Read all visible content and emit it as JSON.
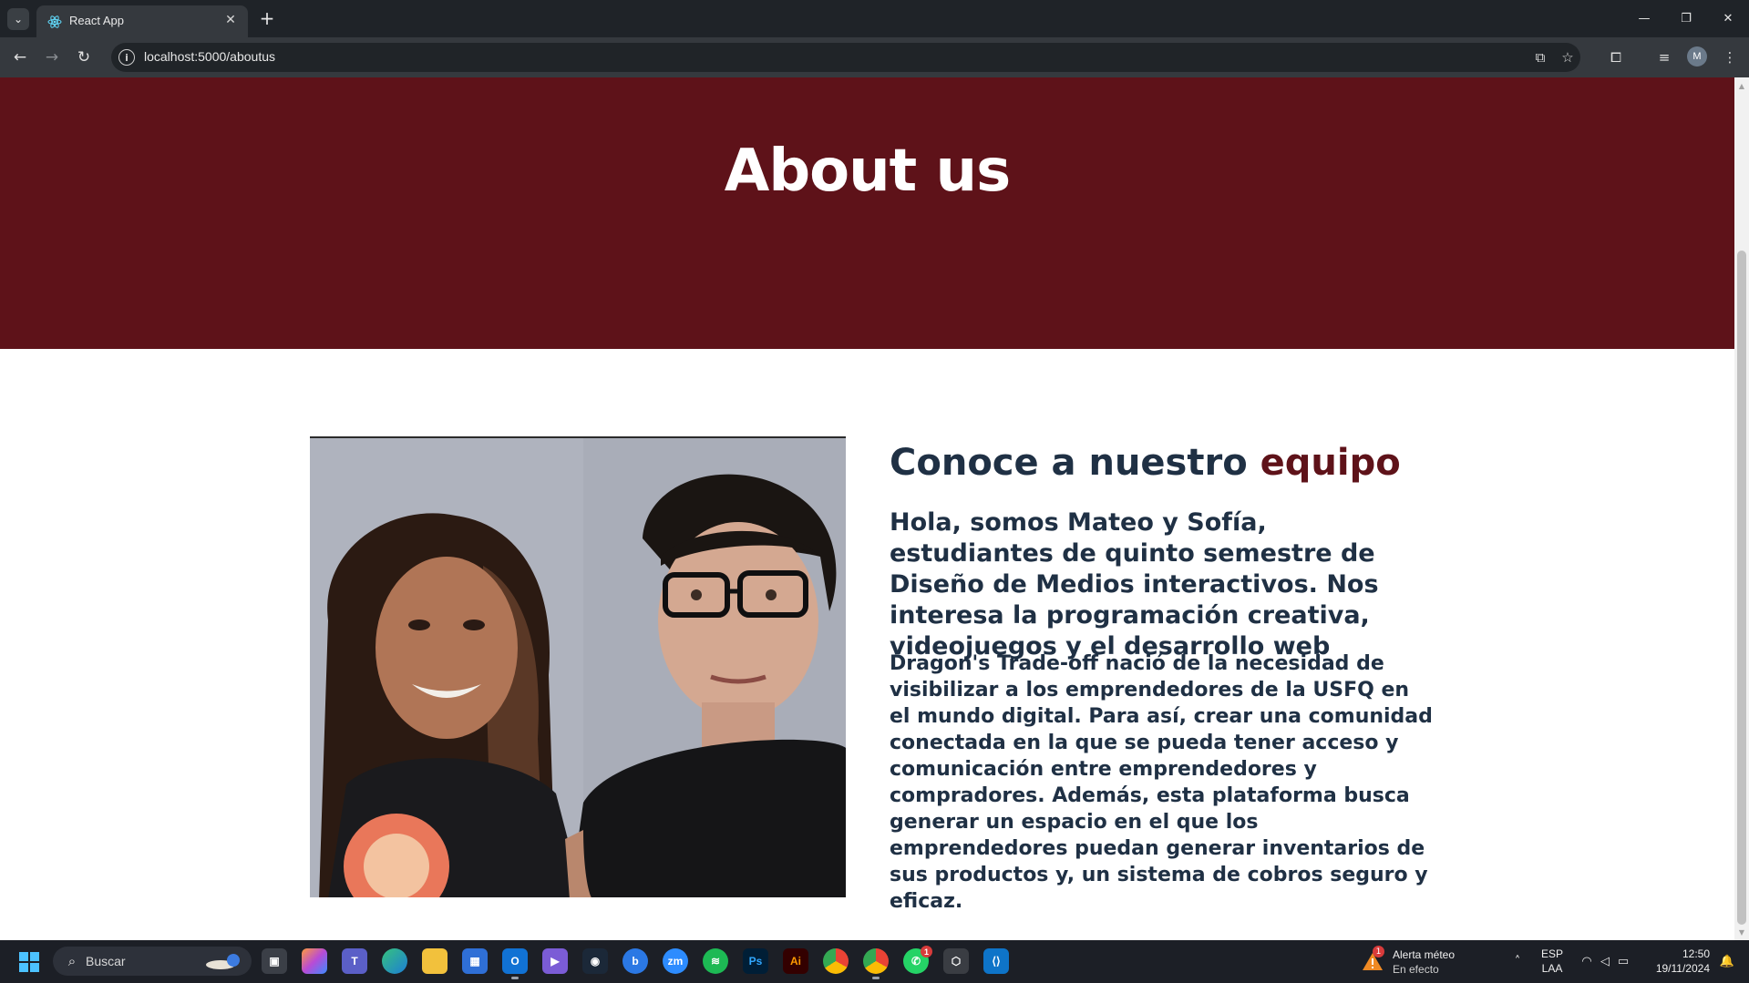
{
  "browser": {
    "tab_title": "React App",
    "url": "localhost:5000/aboutus",
    "profile_initial": "M"
  },
  "hero": {
    "title": "About us",
    "background_color": "#5e1219"
  },
  "about": {
    "title_main": "Conoce a nuestro ",
    "title_accent": "equipo",
    "accent_color": "#5e1219",
    "text_color": "#1f3044",
    "intro": "Hola, somos Mateo y Sofía, estudiantes de quinto semestre de Diseño de Medios interactivos. Nos interesa la programación creativa, videojuegos y el desarrollo web",
    "body": "Dragon's Trade-off nació de la necesidad de visibilizar a los emprendedores de la USFQ en el mundo digital. Para así, crear una comunidad conectada en la que se pueda tener acceso y comunicación entre emprendedores y compradores. Además, esta plataforma busca generar un espacio en el que los emprendedores puedan generar inventarios de sus productos y, un sistema de cobros seguro y eficaz."
  },
  "taskbar": {
    "search_placeholder": "Buscar",
    "apps": [
      {
        "name": "task-view",
        "label": ""
      },
      {
        "name": "copilot",
        "label": ""
      },
      {
        "name": "teams",
        "label": ""
      },
      {
        "name": "edge",
        "label": ""
      },
      {
        "name": "file-explorer",
        "label": ""
      },
      {
        "name": "microsoft-store",
        "label": ""
      },
      {
        "name": "outlook",
        "label": ""
      },
      {
        "name": "app-purple",
        "label": ""
      },
      {
        "name": "steam",
        "label": ""
      },
      {
        "name": "app-blue",
        "label": ""
      },
      {
        "name": "zoom",
        "label": "zm"
      },
      {
        "name": "spotify",
        "label": ""
      },
      {
        "name": "photoshop",
        "label": "Ps"
      },
      {
        "name": "illustrator",
        "label": "Ai"
      },
      {
        "name": "chrome",
        "label": ""
      },
      {
        "name": "chrome-profile",
        "label": ""
      },
      {
        "name": "whatsapp",
        "label": ""
      },
      {
        "name": "unity",
        "label": ""
      },
      {
        "name": "vscode",
        "label": ""
      }
    ],
    "weather_title": "Alerta méteo",
    "weather_subtitle": "En efecto",
    "weather_badge": "1",
    "whatsapp_badge": "1",
    "lang_top": "ESP",
    "lang_bottom": "LAA",
    "time": "12:50",
    "date": "19/11/2024"
  }
}
